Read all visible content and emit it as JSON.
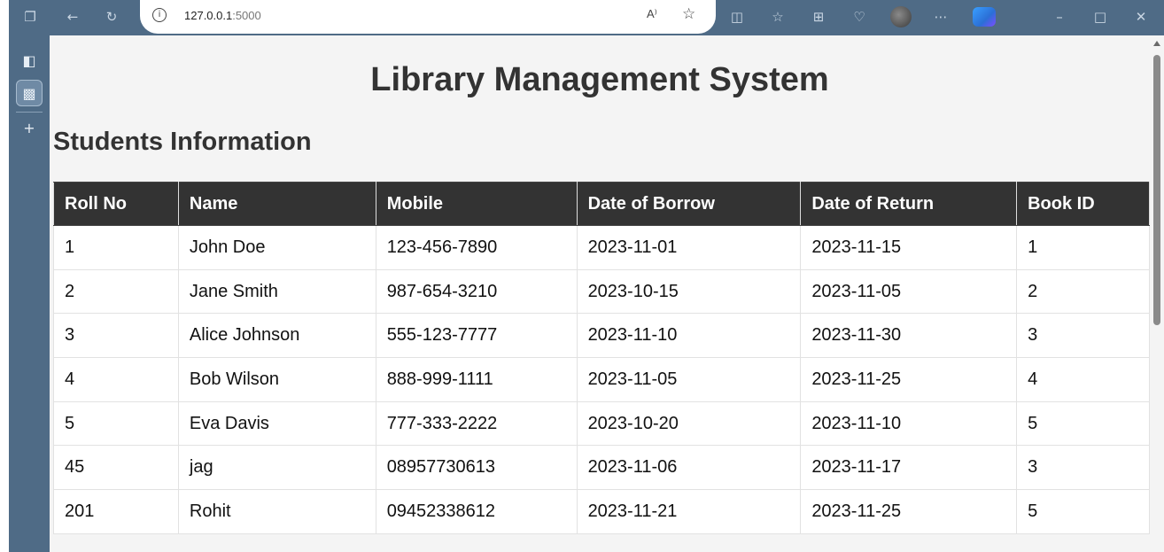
{
  "browser": {
    "address_host": "127.0.0.1",
    "address_port": ":5000",
    "read_aloud_label": "A⁾",
    "info_glyph": "i"
  },
  "icons": {
    "tab_actions": "tab-actions-icon",
    "back": "back-arrow-icon",
    "refresh": "refresh-icon",
    "favorite": "star-icon",
    "split_screen": "split-screen-icon",
    "favorites": "favorites-icon",
    "collections": "collections-icon",
    "browser_essentials": "heart-pulse-icon",
    "more": "more-icon",
    "copilot": "copilot-icon",
    "minimize": "minimize-icon",
    "maximize": "maximize-icon",
    "close": "close-icon",
    "vertical_tabs": "vertical-tabs-icon",
    "active_tab": "terminal-tab-icon",
    "new_tab": "plus-icon"
  },
  "colors": {
    "chrome": "#4f6b86",
    "header_bg": "#333333",
    "page_bg": "#f4f4f4"
  },
  "page": {
    "title": "Library Management System",
    "subtitle": "Students Information"
  },
  "table": {
    "headers": [
      "Roll No",
      "Name",
      "Mobile",
      "Date of Borrow",
      "Date of Return",
      "Book ID"
    ],
    "rows": [
      [
        "1",
        "John Doe",
        "123-456-7890",
        "2023-11-01",
        "2023-11-15",
        "1"
      ],
      [
        "2",
        "Jane Smith",
        "987-654-3210",
        "2023-10-15",
        "2023-11-05",
        "2"
      ],
      [
        "3",
        "Alice Johnson",
        "555-123-7777",
        "2023-11-10",
        "2023-11-30",
        "3"
      ],
      [
        "4",
        "Bob Wilson",
        "888-999-1111",
        "2023-11-05",
        "2023-11-25",
        "4"
      ],
      [
        "5",
        "Eva Davis",
        "777-333-2222",
        "2023-10-20",
        "2023-11-10",
        "5"
      ],
      [
        "45",
        "jag",
        "08957730613",
        "2023-11-06",
        "2023-11-17",
        "3"
      ],
      [
        "201",
        "Rohit",
        "09452338612",
        "2023-11-21",
        "2023-11-25",
        "5"
      ]
    ]
  }
}
